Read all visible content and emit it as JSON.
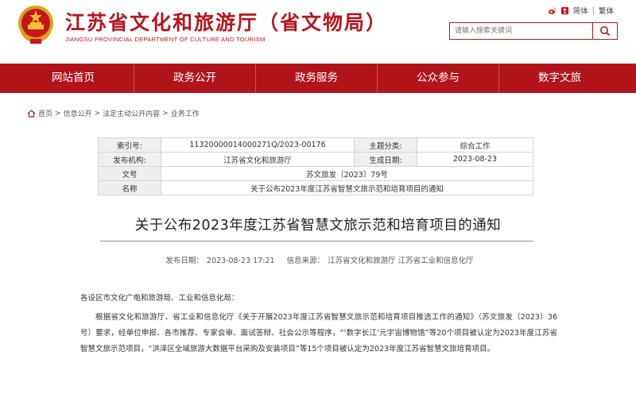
{
  "header": {
    "title_cn": "江苏省文化和旅游厅（省文物局）",
    "title_en": "JIANGSU PROVINCIAL DEPARTMENT OF CULTURE AND TOURISM",
    "emblem_icon": "national-emblem-icon",
    "brand_color": "#b5161e"
  },
  "toplinks": {
    "simplified": "简体",
    "separator": "|",
    "traditional": "繁体"
  },
  "search": {
    "placeholder": "请输入搜索关键词"
  },
  "nav": {
    "items": [
      {
        "label": "网站首页"
      },
      {
        "label": "政务公开"
      },
      {
        "label": "政务服务"
      },
      {
        "label": "公众参与"
      },
      {
        "label": "数字文旅"
      }
    ],
    "background": "#b2141c"
  },
  "breadcrumb": {
    "items": [
      "首页",
      "信息公开",
      "法定主动公开内容",
      "业务工作"
    ],
    "separator": ">"
  },
  "info_table": {
    "index_label": "索引号:",
    "index_value": "11320000014000271Q/2023-00176",
    "topic_label": "主题分类:",
    "topic_value": "综合工作",
    "publisher_label": "发布机构:",
    "publisher_value": "江苏省文化和旅游厅",
    "date_label": "生成日期:",
    "date_value": "2023-08-23",
    "docno_label": "文号",
    "docno_value": "苏文旅发〔2023〕79号",
    "name_label": "名称",
    "name_value": "关于公布2023年度江苏省智慧文旅示范和培育项目的通知"
  },
  "article": {
    "title": "关于公布2023年度江苏省智慧文旅示范和培育项目的通知",
    "publish_date_label": "发布日期：",
    "publish_date": "2023-08-23 17:21",
    "source_label": "信息来源：",
    "source": "江苏省文化和旅游厅 江苏省工业和信息化厅",
    "salutation": "各设区市文化广电和旅游局、工业和信息化局：",
    "paragraph1": "根据省文化和旅游厅、省工业和信息化厅《关于开展2023年度江苏省智慧文旅示范和培育项目推选工作的通知》（苏文旅发〔2023〕36号）要求，经单位申报、各市推荐、专家会审、面试答辩、社会公示等程序，“‘数字长江’元宇宙博物馆”等20个项目被认定为2023年度江苏省智慧文旅示范项目，“洪泽区全域旅游大数据平台采购及安装项目”等15个项目被认定为2023年度江苏省智慧文旅培育项目。"
  }
}
